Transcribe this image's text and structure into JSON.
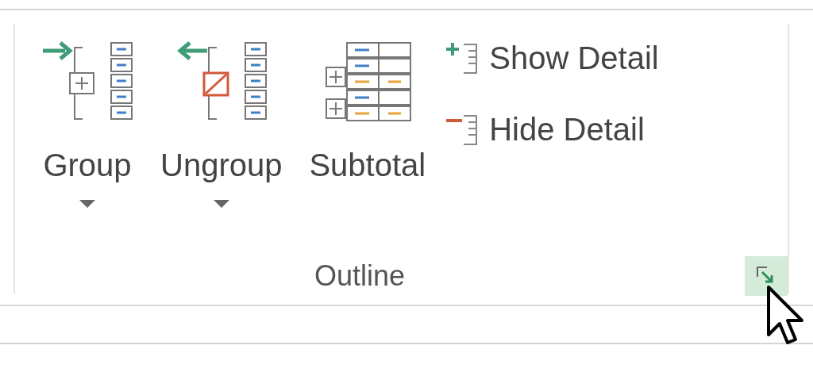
{
  "group": {
    "label": "Outline"
  },
  "large_buttons": [
    {
      "kind": "group",
      "label": "Group",
      "dropdown": true
    },
    {
      "kind": "ungroup",
      "label": "Ungroup",
      "dropdown": true
    },
    {
      "kind": "subtotal",
      "label": "Subtotal",
      "dropdown": false
    }
  ],
  "small_buttons": [
    {
      "kind": "show",
      "label": "Show Detail"
    },
    {
      "kind": "hide",
      "label": "Hide Detail"
    }
  ],
  "dialog_launcher": {
    "hovered": true
  }
}
